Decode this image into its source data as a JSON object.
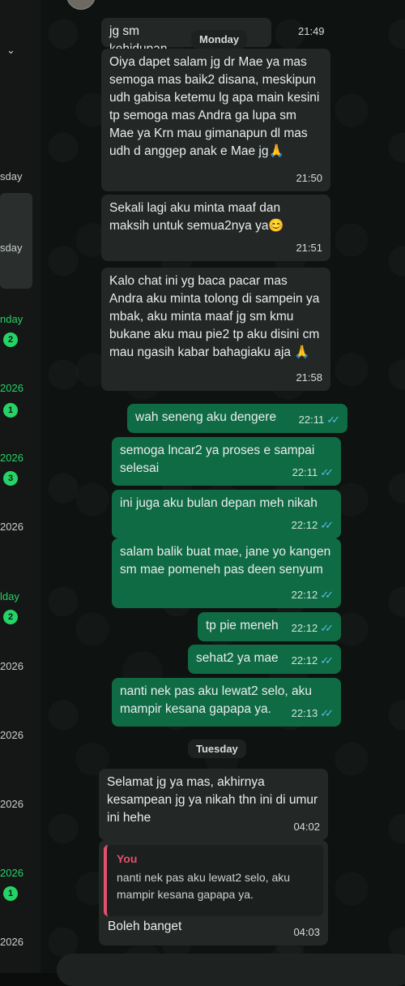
{
  "sidebar": {
    "arrow": "⌄",
    "entries": [
      {
        "date": "sday",
        "badge": null,
        "green": false
      },
      {
        "date": "sday",
        "badge": null,
        "green": false
      },
      {
        "date": "nday",
        "badge": "2",
        "green": true
      },
      {
        "date": "2026",
        "badge": "1",
        "green": true
      },
      {
        "date": "2026",
        "badge": "3",
        "green": true
      },
      {
        "date": "2026",
        "badge": null,
        "green": false
      },
      {
        "date": "lday",
        "badge": "2",
        "green": true
      },
      {
        "date": "2026",
        "badge": null,
        "green": false
      },
      {
        "date": "2026",
        "badge": null,
        "green": false
      },
      {
        "date": "2026",
        "badge": null,
        "green": false
      },
      {
        "date": "2026",
        "badge": "1",
        "green": true
      },
      {
        "date": "2026",
        "badge": null,
        "green": false
      }
    ]
  },
  "chat": {
    "day_monday": "Monday",
    "day_tuesday": "Tuesday",
    "messages": [
      {
        "dir": "in",
        "text": "jg sm kehidupan baruku😁",
        "time": "21:49"
      },
      {
        "dir": "in",
        "text": "Oiya dapet salam jg dr Mae ya mas semoga mas baik2 disana, meskipun udh gabisa ketemu lg apa main kesini tp semoga mas Andra ga lupa sm Mae ya Krn mau gimanapun dl mas udh d anggep anak e Mae jg🙏",
        "time": "21:50"
      },
      {
        "dir": "in",
        "text": "Sekali lagi aku minta maaf dan maksih untuk semua2nya ya😊",
        "time": "21:51"
      },
      {
        "dir": "in",
        "text": "Kalo chat ini yg baca pacar mas Andra aku minta tolong di sampein ya mbak, aku minta maaf jg sm kmu bukane aku mau pie2 tp aku disini cm mau ngasih kabar bahagiaku aja 🙏",
        "time": "21:58"
      },
      {
        "dir": "out",
        "text": "wah seneng aku dengere",
        "time": "22:11"
      },
      {
        "dir": "out",
        "text": "semoga lncar2 ya proses e sampai selesai",
        "time": "22:11"
      },
      {
        "dir": "out",
        "text": "ini juga aku bulan depan meh nikah",
        "time": "22:12"
      },
      {
        "dir": "out",
        "text": "salam balik buat mae, jane yo kangen sm mae pomeneh pas deen senyum",
        "time": "22:12"
      },
      {
        "dir": "out",
        "text": "tp pie meneh",
        "time": "22:12"
      },
      {
        "dir": "out",
        "text": "sehat2 ya mae",
        "time": "22:12"
      },
      {
        "dir": "out",
        "text": "nanti nek pas aku lewat2 selo, aku mampir kesana gapapa ya.",
        "time": "22:13"
      },
      {
        "dir": "in",
        "text": "Selamat jg ya mas, akhirnya kesampean jg ya nikah thn ini di umur ini hehe",
        "time": "04:02"
      },
      {
        "dir": "in",
        "text": "Boleh banget",
        "time": "04:03",
        "quote": {
          "author": "You",
          "text": "nanti nek pas aku lewat2 selo, aku mampir kesana gapapa ya."
        }
      }
    ]
  },
  "colors": {
    "incoming": "#232826",
    "outgoing": "#0f6b43",
    "read_ticks": "#53bdeb",
    "badge": "#25d366",
    "quote_accent": "#e2516e"
  }
}
